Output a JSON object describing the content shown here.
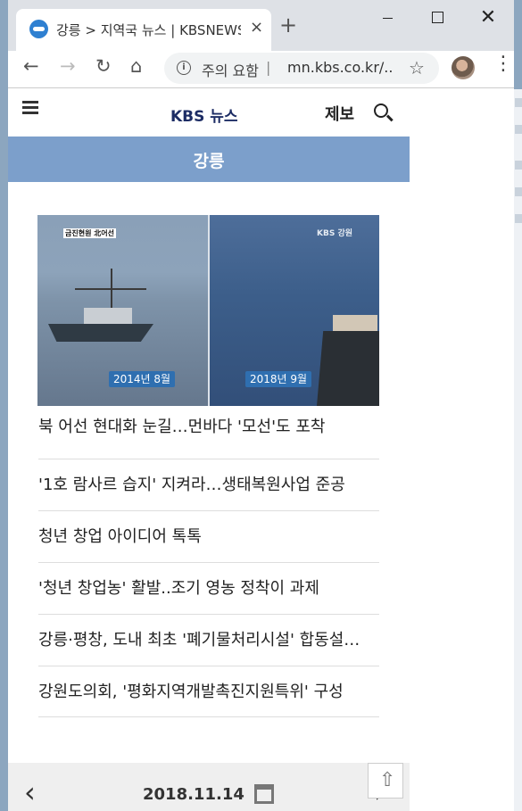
{
  "browser": {
    "tab_title": "강릉 > 지역국 뉴스 | KBSNEWS",
    "tab_close": "×",
    "new_tab": "+",
    "close_window": "✕",
    "back": "←",
    "forward": "→",
    "reload": "↻",
    "home": "⌂",
    "security_info": "i",
    "security_warning": "주의 요함",
    "separator": "|",
    "url": "mn.kbs.co.kr/...",
    "star": "☆",
    "menu": "⋮"
  },
  "header": {
    "brand": "KBS 뉴스",
    "tip": "제보"
  },
  "region": {
    "label": "강릉"
  },
  "hero": {
    "caption_left": "금진현원 北어선",
    "caption_right": "KBS 강원",
    "badge_left": "2014년 8월",
    "badge_right": "2018년 9월"
  },
  "lead_title": "북 어선 현대화 눈길…먼바다 '모선'도 포착",
  "news": [
    "'1호 람사르 습지' 지켜라…생태복원사업 준공",
    "청년 창업 아이디어 톡톡",
    "'청년 창업농' 활발..조기 영농 정착이 과제",
    "강릉·평창, 도내 최초 '폐기물처리시설' 합동설…",
    "강원도의회, '평화지역개발촉진지원특위' 구성"
  ],
  "footer": {
    "prev": "‹",
    "date": "2018.11.14",
    "next": "›",
    "scroll_top": "⇧"
  }
}
